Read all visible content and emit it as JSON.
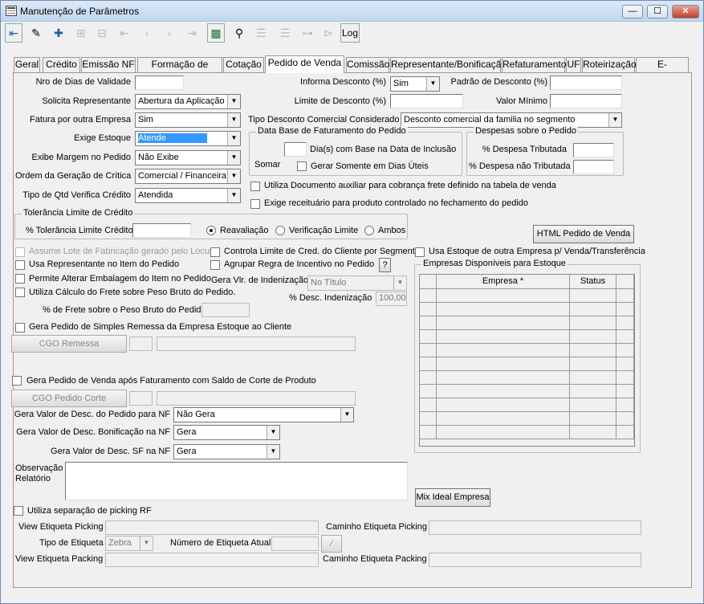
{
  "window": {
    "title": "Manutenção de Parâmetros",
    "btn_min": "—",
    "btn_max": "☐",
    "btn_close": "✕"
  },
  "toolbar": {
    "log_label": "Log"
  },
  "tabs": [
    {
      "label": "Geral"
    },
    {
      "label": "Crédito"
    },
    {
      "label": "Emissão NF"
    },
    {
      "label": "Formação de Preço"
    },
    {
      "label": "Cotação"
    },
    {
      "label": "Pedido de Venda"
    },
    {
      "label": "Comissão"
    },
    {
      "label": "Representante/Bonificação"
    },
    {
      "label": "Refaturamento"
    },
    {
      "label": "UF"
    },
    {
      "label": "Roteirização"
    },
    {
      "label": "E-commerce"
    }
  ],
  "form": {
    "nro_dias_validade": {
      "label": "Nro de Dias de Validade",
      "value": ""
    },
    "solicita_representante": {
      "label": "Solicita Representante",
      "value": "Abertura da Aplicação"
    },
    "fatura_outra_empresa": {
      "label": "Fatura por outra Empresa",
      "value": "Sim"
    },
    "exige_estoque": {
      "label": "Exige Estoque",
      "value": "Atende"
    },
    "exibe_margem": {
      "label": "Exibe Margem no Pedido",
      "value": "Não Exibe"
    },
    "ordem_critica": {
      "label": "Ordem da Geração de Crítica",
      "value": "Comercial / Financeira"
    },
    "tipo_qtd": {
      "label": "Tipo de Qtd Verifica Crédito",
      "value": "Atendida"
    },
    "informa_desconto": {
      "label": "Informa Desconto (%)",
      "value": "Sim"
    },
    "padrao_desconto": {
      "label": "Padrão de Desconto (%)",
      "value": ""
    },
    "limite_desconto": {
      "label": "Limite de Desconto (%)",
      "value": ""
    },
    "valor_minimo": {
      "label": "Valor Mínimo",
      "value": ""
    },
    "tipo_desconto": {
      "label": "Tipo Desconto Comercial Considerado",
      "value": "Desconto comercial da familia no segmento"
    },
    "data_base": {
      "title": "Data Base de Faturamento do Pedido",
      "dias_label": "Dia(s)  com Base na Data de Inclusão",
      "somar_label": "Somar",
      "uteis_label": "Gerar Somente em Dias Úteis",
      "dias_value": ""
    },
    "despesas": {
      "title": "Despesas sobre o Pedido",
      "tributada_label": "% Despesa Tributada",
      "nao_tributada_label": "% Despesa não Tributada",
      "tributada_value": "",
      "nao_tributada_value": ""
    },
    "utiliza_doc_aux": "Utiliza Documento auxiliar para cobrança frete definido na tabela de venda",
    "exige_receituario": "Exige receituário para produto controlado no fechamento do pedido",
    "tolerancia": {
      "title": "Tolerância Limite de Crédito",
      "label": "% Tolerância Limite Crédito",
      "value": "",
      "opt1": "Reavaliação",
      "opt2": "Verificação Limite",
      "opt3": "Ambos"
    },
    "html_pedido_btn": "HTML Pedido de Venda",
    "assume_lote": "Assume Lote de Fabricação gerado pelo Locus",
    "usa_representante": "Usa Representante no Item do Pedido",
    "permite_alterar": "Permite Alterar Embalagem do Item no Pedido",
    "utiliza_calculo": "Utiliza Cálculo do Frete sobre Peso Bruto do Pedido.",
    "pct_frete": {
      "label": "% de Frete sobre o Peso Bruto do Pedido",
      "value": ""
    },
    "controla_limite": "Controla Limite de Cred. do Cliente por Segmento",
    "agrupar_regra": "Agrupar Regra de Incentivo no Pedido",
    "help_btn": "?",
    "gera_vlr_indenizacao": {
      "label": "Gera Vlr. de Indenização",
      "value": "No Título"
    },
    "pct_desc_indenizacao": {
      "label": "% Desc. Indenização",
      "value": "100,00"
    },
    "usa_estoque_outra": "Usa Estoque de outra Empresa p/ Venda/Transferência",
    "empresas": {
      "title": "Empresas Disponíveis para Estoque",
      "col_empresa": "Empresa *",
      "col_status": "Status"
    },
    "gera_simples_remessa": "Gera Pedido de Simples Remessa da Empresa Estoque ao Cliente",
    "cgo_remessa_btn": "CGO Remessa",
    "gera_pedido_venda": "Gera Pedido de Venda após Faturamento com Saldo de Corte de Produto",
    "cgo_corte_btn": "CGO Pedido Corte",
    "gera_valor_desc": {
      "label": "Gera Valor de Desc. do Pedido para NF",
      "value": "Não Gera"
    },
    "gera_valor_bonif": {
      "label": "Gera Valor de Desc. Bonificação na NF",
      "value": "Gera"
    },
    "gera_valor_sf": {
      "label": "Gera Valor de Desc. SF na NF",
      "value": "Gera"
    },
    "observacao": {
      "label1": "Observação",
      "label2": "Relatório",
      "value": ""
    },
    "mix_ideal_btn": "Mix Ideal Empresa",
    "utiliza_picking": "Utiliza separação de picking RF",
    "view_picking": {
      "label": "View Etiqueta Picking",
      "value": ""
    },
    "caminho_picking": {
      "label": "Caminho Etiqueta Picking",
      "value": ""
    },
    "tipo_etiqueta": {
      "label": "Tipo de Etiqueta",
      "value": "Zebra"
    },
    "numero_etiqueta": {
      "label": "Número de Etiqueta Atual",
      "value": ""
    },
    "view_packing": {
      "label": "View Etiqueta Packing",
      "value": ""
    },
    "caminho_packing": {
      "label": "Caminho Etiqueta Packing",
      "value": ""
    }
  }
}
